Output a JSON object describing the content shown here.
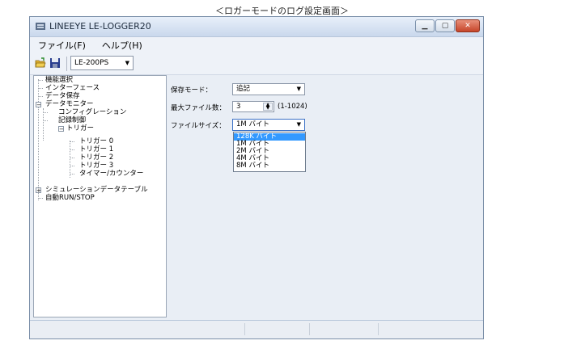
{
  "caption": "＜ロガーモードのログ設定画面＞",
  "window": {
    "title": "LINEEYE LE-LOGGER20",
    "controls": [
      "minimize",
      "maximize",
      "close"
    ]
  },
  "menubar": {
    "file": "ファイル(F)",
    "help": "ヘルプ(H)"
  },
  "toolbar": {
    "open_icon": "open-folder-icon",
    "save_icon": "save-disk-icon",
    "model": "LE-200PS"
  },
  "tree": {
    "items": [
      {
        "label": "機能選択"
      },
      {
        "label": "インターフェース"
      },
      {
        "label": "データ保存"
      },
      {
        "label": "データモニター",
        "expanded": true
      },
      {
        "label": "コンフィグレーション"
      },
      {
        "label": "記録制御"
      },
      {
        "label": "トリガー",
        "expanded": true
      },
      {
        "label": "トリガー 0"
      },
      {
        "label": "トリガー 1"
      },
      {
        "label": "トリガー 2"
      },
      {
        "label": "トリガー 3"
      },
      {
        "label": "タイマー/カウンター"
      },
      {
        "label": "シミュレーションデータテーブル",
        "expanded": false
      },
      {
        "label": "自動RUN/STOP"
      }
    ]
  },
  "settings": {
    "save_mode_label": "保存モード：",
    "save_mode_value": "追記",
    "max_files_label": "最大ファイル数：",
    "max_files_value": "3",
    "max_files_range": "(1-1024)",
    "file_size_label": "ファイルサイズ：",
    "file_size_value": "1M バイト",
    "file_size_options": [
      "128K バイト",
      "1M バイト",
      "2M バイト",
      "4M バイト",
      "8M バイト"
    ],
    "highlighted_option": "128K バイト"
  },
  "colors": {
    "selection": "#3399ff",
    "window_bg": "#e9eef5",
    "close_button": "#c6452a"
  }
}
